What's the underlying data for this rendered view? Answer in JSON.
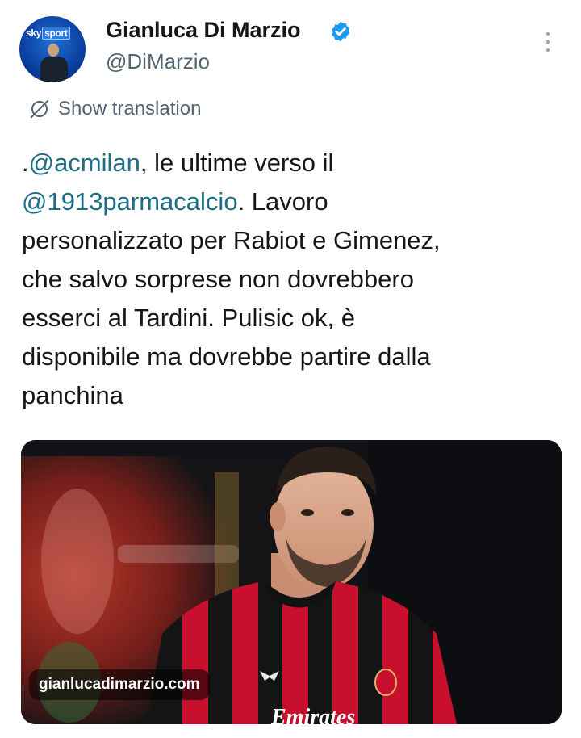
{
  "author": {
    "name": "Gianluca Di Marzio",
    "handle": "@DiMarzio",
    "avatar_logo_text": "sky",
    "avatar_logo_badge": "sport"
  },
  "actions": {
    "translate_label": "Show translation"
  },
  "tweet": {
    "segments": [
      {
        "text": ".",
        "type": "text"
      },
      {
        "text": "@acmilan",
        "type": "mention"
      },
      {
        "text": ", le ultime verso il",
        "type": "text"
      },
      {
        "text": "@1913parmacalcio",
        "type": "mention"
      },
      {
        "text": ". Lavoro",
        "type": "text"
      },
      {
        "text": "personalizzato per Rabiot e Gimenez,",
        "type": "text"
      },
      {
        "text": "che salvo sorprese non dovrebbero",
        "type": "text"
      },
      {
        "text": "esserci al Tardini. Pulisic ok, è",
        "type": "text"
      },
      {
        "text": "disponibile ma dovrebbe partire dalla",
        "type": "text"
      },
      {
        "text": "panchina",
        "type": "text"
      }
    ]
  },
  "media": {
    "caption": "gianlucadimarzio.com",
    "shirt_text": "Emirates"
  },
  "colors": {
    "mention": "#1d6f86",
    "verified": "#1d9bf0",
    "secondary_text": "#536471"
  },
  "icons": {
    "verified": "verified-badge-icon",
    "more": "more-vertical-icon",
    "translate": "globe-translate-icon"
  }
}
